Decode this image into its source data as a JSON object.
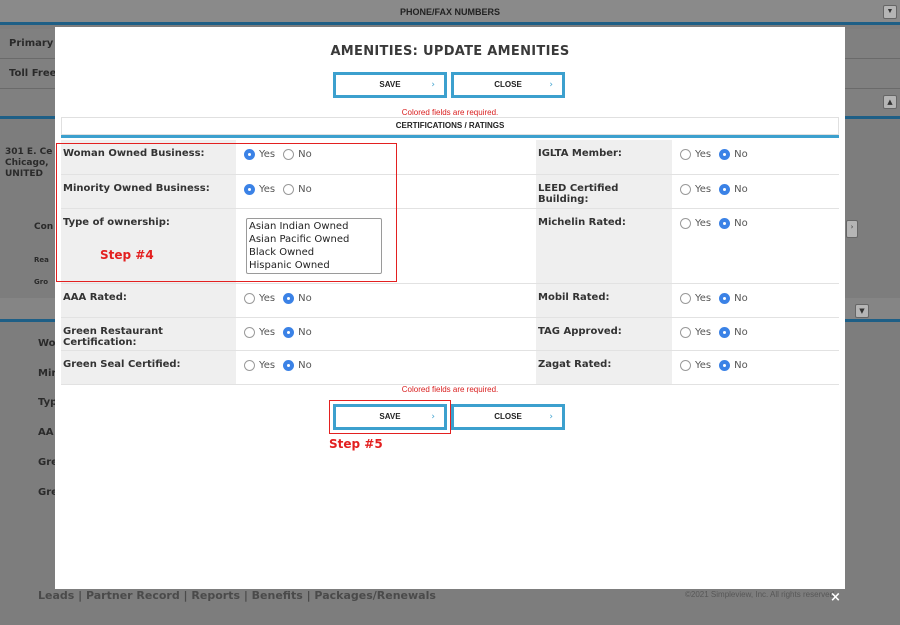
{
  "background": {
    "top_bar_title": "PHONE/FAX NUMBERS",
    "labels": [
      "Primary",
      "Toll Free",
      "301 E. Ce",
      "Chicago,",
      "UNITED",
      "Con",
      "Rea",
      "Gro",
      "Wo",
      "Mir",
      "Typ",
      "AA",
      "Gre",
      "Gre"
    ],
    "footer_links": "Leads  |  Partner Record  |  Reports  |  Benefits  |  Packages/Renewals",
    "copyright": "©2021 Simpleview, Inc. All rights reserved."
  },
  "modal": {
    "title": "AMENITIES: UPDATE AMENITIES",
    "save_label": "SAVE",
    "close_label": "CLOSE",
    "required_note": "Colored fields are required.",
    "section_title": "CERTIFICATIONS / RATINGS",
    "close_x": "×",
    "yes": "Yes",
    "no": "No",
    "fields": {
      "woman_owned": {
        "label": "Woman Owned Business:",
        "value": "Yes"
      },
      "minority_owned": {
        "label": "Minority Owned Business:",
        "value": "Yes"
      },
      "ownership_type": {
        "label": "Type of ownership:",
        "options": [
          "Asian Indian Owned",
          "Asian Pacific Owned",
          "Black Owned",
          "Hispanic Owned"
        ]
      },
      "aaa_rated": {
        "label": "AAA Rated:",
        "value": "No"
      },
      "green_restaurant": {
        "label": "Green Restaurant Certification:",
        "value": "No"
      },
      "green_seal": {
        "label": "Green Seal Certified:",
        "value": "No"
      },
      "iglta": {
        "label": "IGLTA Member:",
        "value": "No"
      },
      "leed": {
        "label": "LEED Certified Building:",
        "value": "No"
      },
      "michelin": {
        "label": "Michelin Rated:",
        "value": "No"
      },
      "mobil": {
        "label": "Mobil Rated:",
        "value": "No"
      },
      "tag": {
        "label": "TAG Approved:",
        "value": "No"
      },
      "zagat": {
        "label": "Zagat Rated:",
        "value": "No"
      }
    }
  },
  "annotations": {
    "step4": "Step #4",
    "step5": "Step #5"
  },
  "colors": {
    "accent": "#3ca0ce",
    "required": "#d92020",
    "annotation": "#e32020",
    "radio_selected": "#3b82e6"
  }
}
